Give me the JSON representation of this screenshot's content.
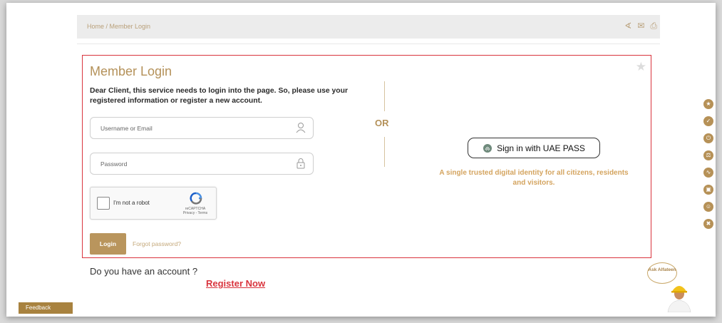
{
  "breadcrumb": {
    "text": "Home / Member Login"
  },
  "header_tools": {
    "share": "share-icon",
    "mail": "mail-icon",
    "print": "print-icon"
  },
  "login": {
    "title": "Member Login",
    "intro": "Dear Client, this service needs to login into the page. So, please use your registered information or register a new account.",
    "username_placeholder": "Username or Email",
    "password_placeholder": "Password",
    "captcha_label": "I'm not a robot",
    "captcha_brand": "reCAPTCHA",
    "captcha_terms": "Privacy - Terms",
    "login_label": "Login",
    "forgot_label": "Forgot password?"
  },
  "or_label": "OR",
  "uaepass": {
    "button_label": "Sign in with UAE PASS",
    "description": "A single trusted digital identity for all citizens, residents and visitors."
  },
  "account": {
    "question": "Do you have an account ?",
    "register_label": "Register Now"
  },
  "assistant": {
    "label": "Ask Alfateen"
  },
  "feedback": {
    "label": "Feedback"
  },
  "colors": {
    "accent": "#b49159",
    "highlight": "#d9343d",
    "uaepass_text": "#d4a45f"
  }
}
